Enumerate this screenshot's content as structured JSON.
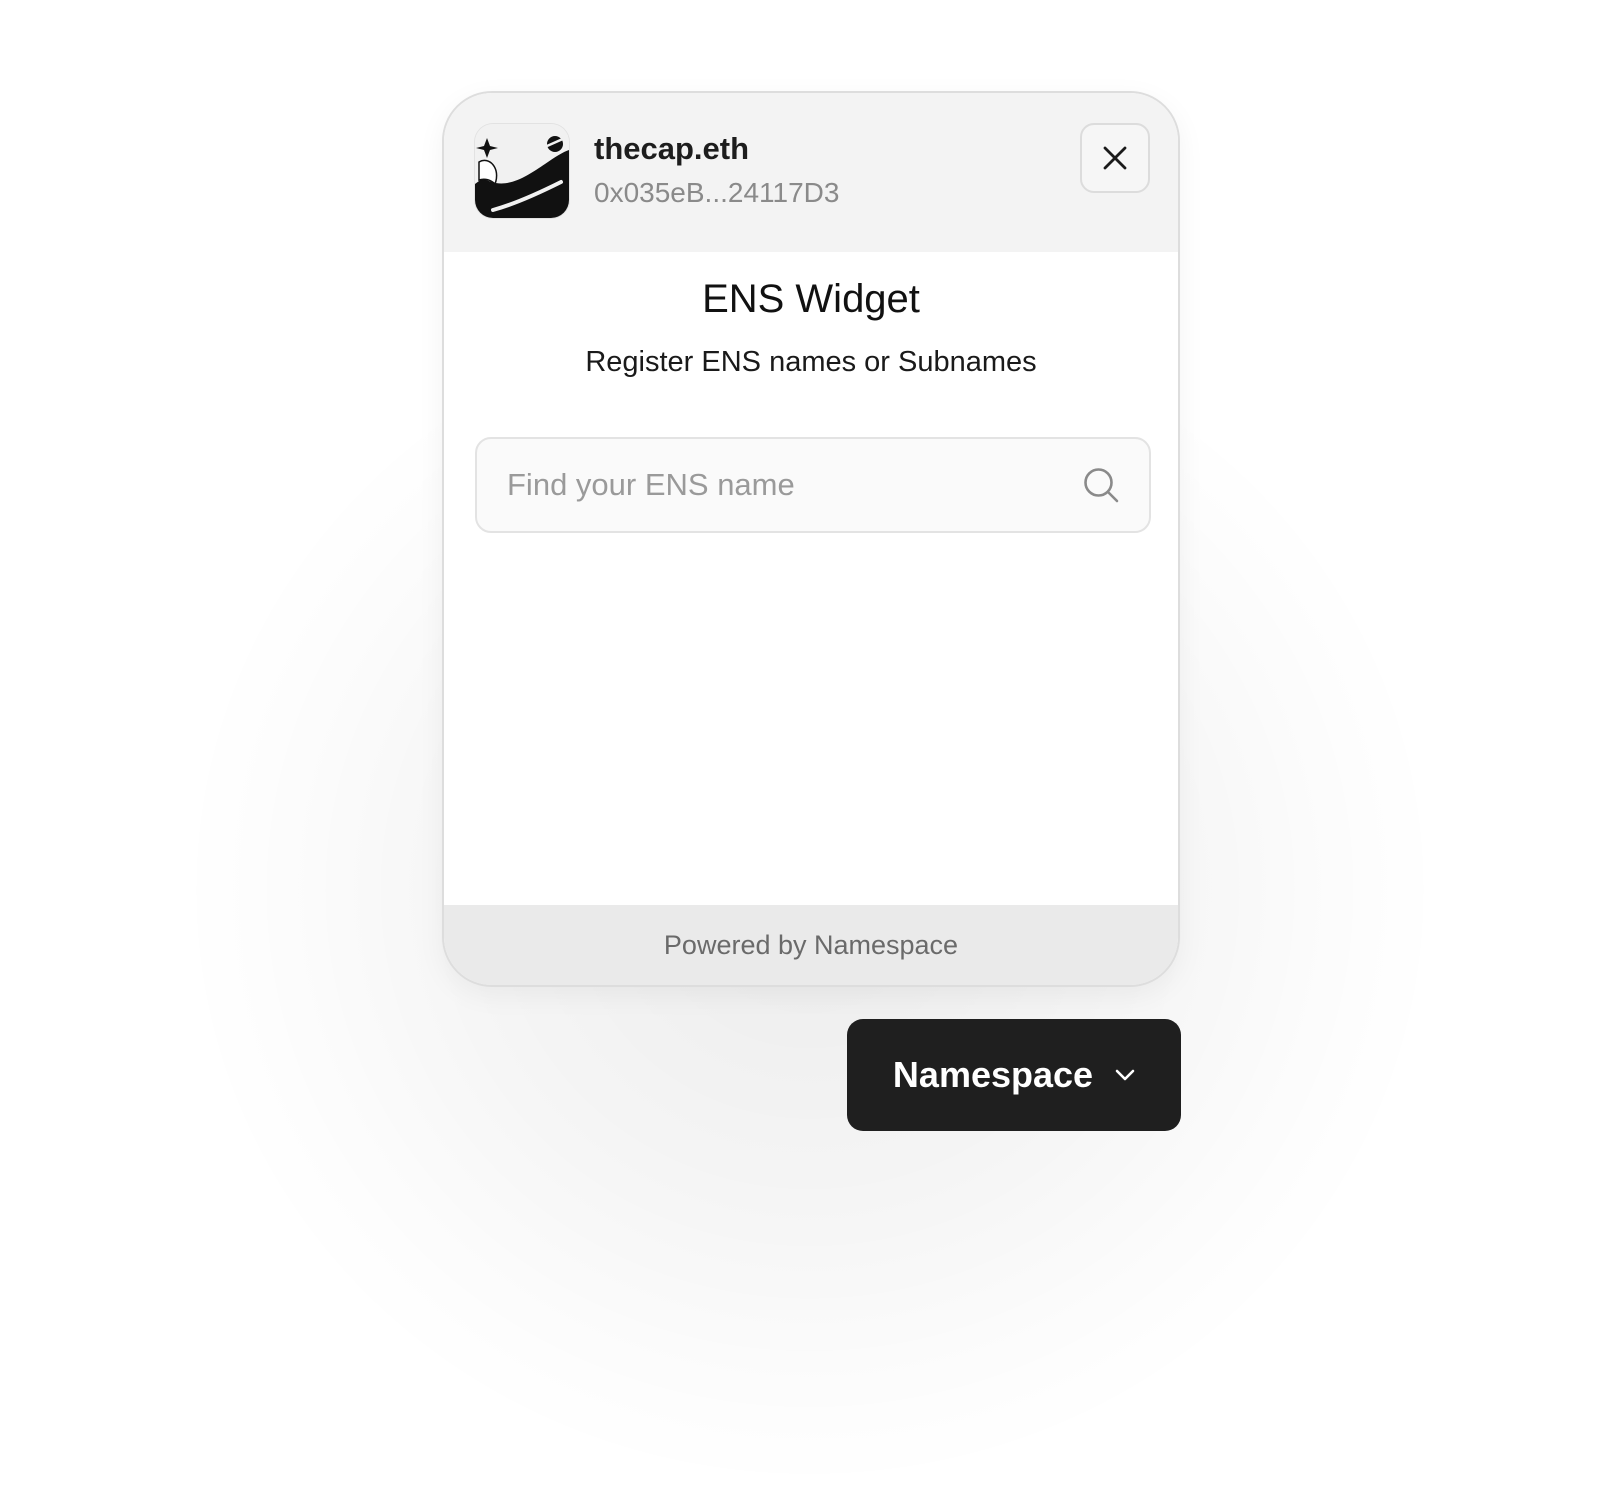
{
  "widget": {
    "account": {
      "name": "thecap.eth",
      "address": "0x035eB...24117D3",
      "avatar_icon": "avatar-image"
    },
    "close_icon": "close-icon",
    "title": "ENS Widget",
    "subtitle": "Register ENS names or Subnames",
    "search": {
      "placeholder": "Find your ENS name",
      "value": "",
      "icon": "search-icon"
    },
    "footer": {
      "powered_by": "Powered by Namespace"
    }
  },
  "launcher": {
    "label": "Namespace",
    "icon": "chevron-down-icon",
    "background": "#1f1f1f",
    "text_color": "#ffffff"
  }
}
